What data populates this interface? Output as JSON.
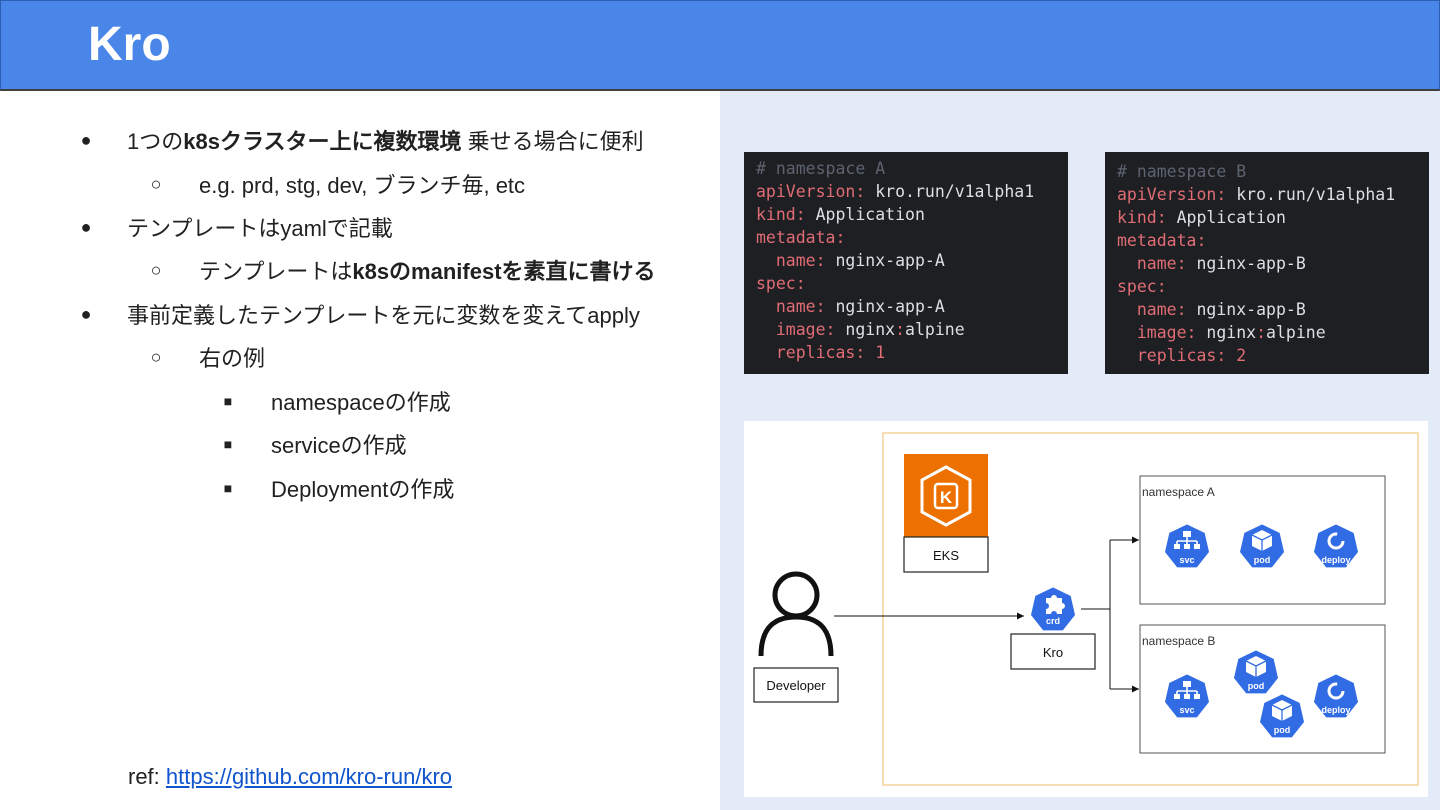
{
  "slide": {
    "title": "Kro"
  },
  "bullets": {
    "b1": {
      "pre": "1つの",
      "bold": "k8sクラスター上に複数環境",
      "post": " 乗せる場合に便利"
    },
    "b1_1": "e.g. prd, stg, dev, ブランチ毎, etc",
    "b2": "テンプレートはyamlで記載",
    "b2_1": {
      "pre": "テンプレートは",
      "bold": "k8sのmanifestを素直に書ける"
    },
    "b3": "事前定義したテンプレートを元に変数を変えてapply",
    "b3_1": "右の例",
    "b3_1_1": "namespaceの作成",
    "b3_1_2": "serviceの作成",
    "b3_1_3": "Deploymentの作成",
    "markers": {
      "l1": "●",
      "l2": "○",
      "l3": "■"
    }
  },
  "ref": {
    "label": "ref: ",
    "link": "https://github.com/kro-run/kro"
  },
  "code_a": {
    "comment": "# namespace A",
    "apiVersion_key": "apiVersion",
    "apiVersion_val": "kro.run/v1alpha1",
    "kind_key": "kind",
    "kind_val": "Application",
    "metadata_key": "metadata",
    "name_key": "name",
    "meta_name_val": "nginx-app-A",
    "spec_key": "spec",
    "spec_name_val": "nginx-app-A",
    "image_key": "image",
    "image_repo": "nginx",
    "image_tag": "alpine",
    "replicas_key": "replicas",
    "replicas_val": "1"
  },
  "code_b": {
    "comment": "# namespace B",
    "apiVersion_key": "apiVersion",
    "apiVersion_val": "kro.run/v1alpha1",
    "kind_key": "kind",
    "kind_val": "Application",
    "metadata_key": "metadata",
    "name_key": "name",
    "meta_name_val": "nginx-app-B",
    "spec_key": "spec",
    "spec_name_val": "nginx-app-B",
    "image_key": "image",
    "image_repo": "nginx",
    "image_tag": "alpine",
    "replicas_key": "replicas",
    "replicas_val": "2"
  },
  "diagram": {
    "eks_label": "EKS",
    "eks_logo_letter": "K",
    "kro_label": "Kro",
    "crd_label": "crd",
    "developer_label": "Developer",
    "ns_a_label": "namespace A",
    "ns_b_label": "namespace B",
    "svc_label": "svc",
    "pod_label": "pod",
    "deploy_label": "deploy",
    "colors": {
      "k8s_blue": "#326ce5",
      "eks_orange": "#ed7100",
      "cluster_border": "#f5d39a"
    }
  }
}
